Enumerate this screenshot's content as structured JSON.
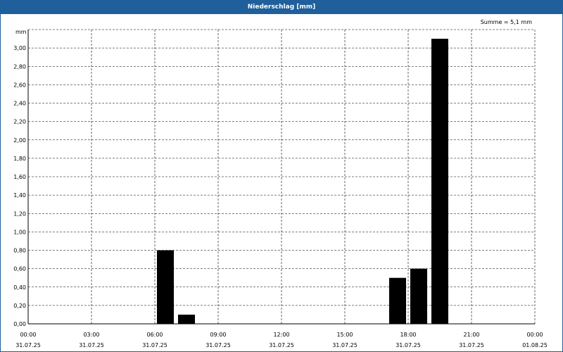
{
  "window": {
    "title": "Niederschlag [mm]"
  },
  "chart_data": {
    "type": "bar",
    "title": "Niederschlag [mm]",
    "annotation": "Summe = 5,1 mm",
    "ylabel": "mm",
    "ylim": [
      0,
      3.2
    ],
    "yticks": [
      "0,00",
      "0,20",
      "0,40",
      "0,60",
      "0,80",
      "1,00",
      "1,20",
      "1,40",
      "1,60",
      "1,80",
      "2,00",
      "2,20",
      "2,40",
      "2,60",
      "2,80",
      "3,00"
    ],
    "xlim_hours": [
      0,
      24
    ],
    "xticks": [
      {
        "hour": 0,
        "time": "00:00",
        "date": "31.07.25"
      },
      {
        "hour": 3,
        "time": "03:00",
        "date": "31.07.25"
      },
      {
        "hour": 6,
        "time": "06:00",
        "date": "31.07.25"
      },
      {
        "hour": 9,
        "time": "09:00",
        "date": "31.07.25"
      },
      {
        "hour": 12,
        "time": "12:00",
        "date": "31.07.25"
      },
      {
        "hour": 15,
        "time": "15:00",
        "date": "31.07.25"
      },
      {
        "hour": 18,
        "time": "18:00",
        "date": "31.07.25"
      },
      {
        "hour": 21,
        "time": "21:00",
        "date": "31.07.25"
      },
      {
        "hour": 24,
        "time": "00:00",
        "date": "01.08.25"
      }
    ],
    "bars": [
      {
        "time": "06:00",
        "value": 0.8
      },
      {
        "time": "07:00",
        "value": 0.1
      },
      {
        "time": "17:00",
        "value": 0.5
      },
      {
        "time": "18:00",
        "value": 0.6
      },
      {
        "time": "19:00",
        "value": 3.1
      }
    ],
    "grid": true,
    "bar_color": "#000000",
    "grid_color": "#000000"
  }
}
